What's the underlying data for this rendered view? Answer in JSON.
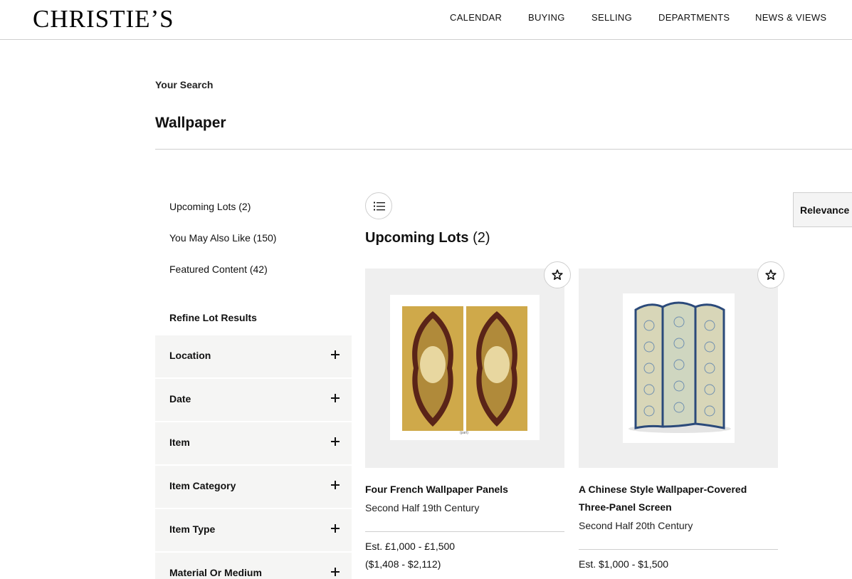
{
  "header": {
    "logo": "CHRISTIE’S",
    "nav": [
      "CALENDAR",
      "BUYING",
      "SELLING",
      "DEPARTMENTS",
      "NEWS & VIEWS"
    ]
  },
  "search": {
    "label": "Your Search",
    "query": "Wallpaper"
  },
  "sidebar": {
    "links": [
      "Upcoming Lots (2)",
      "You May Also Like (150)",
      "Featured Content (42)"
    ],
    "refine_title": "Refine Lot Results",
    "filters": [
      "Location",
      "Date",
      "Item",
      "Item Category",
      "Item Type",
      "Material Or Medium"
    ]
  },
  "results": {
    "title": "Upcoming Lots",
    "count": "(2)",
    "sort_label": "Relevance",
    "lots": [
      {
        "title": "Four French Wallpaper Panels",
        "subtitle": "Second Half 19th Century",
        "estimate": "Est. £1,000 - £1,500",
        "estimate_converted": "($1,408 - $2,112)",
        "image_caption": "(part)"
      },
      {
        "title_line1": "A Chinese Style Wallpaper-Covered",
        "title_line2": "Three-Panel Screen",
        "subtitle": "Second Half 20th Century",
        "estimate": "Est. $1,000 - $1,500"
      }
    ]
  },
  "colors": {
    "panel_bg": "#f5f5f4",
    "image_bg": "#efefef",
    "divider": "#cfcfcf"
  }
}
